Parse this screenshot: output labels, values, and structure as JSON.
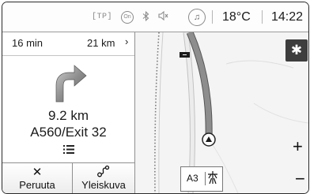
{
  "status_bar": {
    "tp": "[TP]",
    "on": "On",
    "bluetooth_icon": "bluetooth-icon",
    "mute_icon": "speaker-muted-icon",
    "media_icon": "music-note-icon",
    "temperature": "18°C",
    "time": "14:22"
  },
  "route_summary": {
    "time": "16 min",
    "distance": "21 km",
    "chevron": "›"
  },
  "next_maneuver": {
    "arrow_icon": "turn-right-arrow-icon",
    "distance": "9.2 km",
    "road": "A560/Exit 32",
    "list_icon": "list-icon"
  },
  "buttons": {
    "cancel_icon": "✕",
    "cancel_label": "Peruuta",
    "overview_icon": "route-overview-icon",
    "overview_label": "Yleiskuva"
  },
  "map": {
    "settings_icon": "gear-icon",
    "zoom_in": "+",
    "zoom_out": "−",
    "road_label": "A3",
    "road_icon": "motorway-icon"
  },
  "colors": {
    "route": "#8d8d8d",
    "map_bg": "#f4f4f4",
    "settings_bg": "#3d3d3d"
  }
}
